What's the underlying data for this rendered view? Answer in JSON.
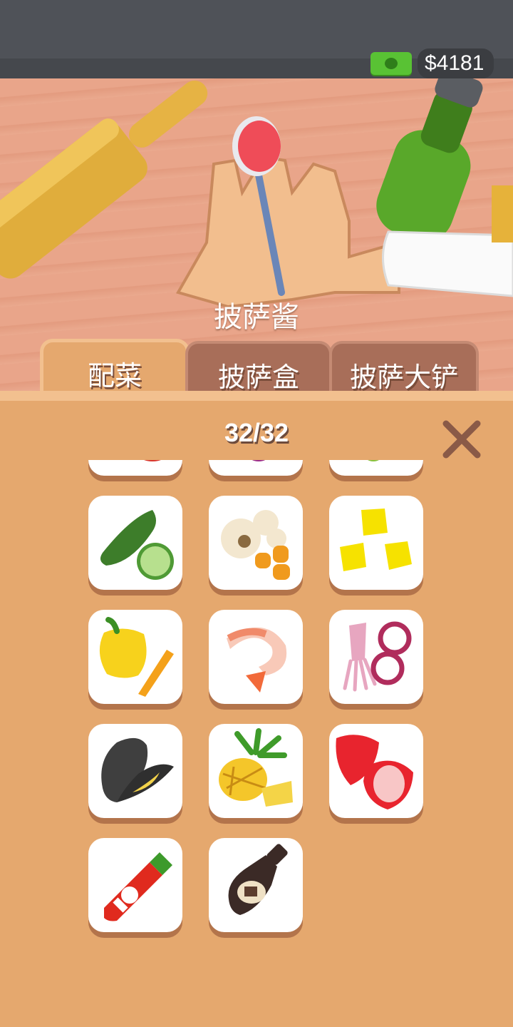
{
  "header": {
    "money": "$4181",
    "money_icon": "cash-icon"
  },
  "scene": {
    "current_item_label": "披萨酱"
  },
  "tabs": [
    {
      "label": "配菜",
      "active": true
    },
    {
      "label": "披萨盒",
      "active": false
    },
    {
      "label": "披萨大铲",
      "active": false
    }
  ],
  "panel": {
    "counter": "32/32",
    "close_icon": "close-icon"
  },
  "items": [
    {
      "name": "cucumber-zucchini-icon"
    },
    {
      "name": "mushroom-carrot-icon"
    },
    {
      "name": "corn-kernels-icon"
    },
    {
      "name": "yellow-pepper-icon"
    },
    {
      "name": "shrimp-icon"
    },
    {
      "name": "squid-onion-icon"
    },
    {
      "name": "mussel-icon"
    },
    {
      "name": "pineapple-icon"
    },
    {
      "name": "strawberry-icon"
    },
    {
      "name": "hot-sauce-icon"
    },
    {
      "name": "chocolate-syrup-icon"
    }
  ],
  "colors": {
    "background": "#e5a86e",
    "tab_inactive": "#a86e59",
    "topbar": "#4f5258",
    "money_green": "#59c234"
  }
}
